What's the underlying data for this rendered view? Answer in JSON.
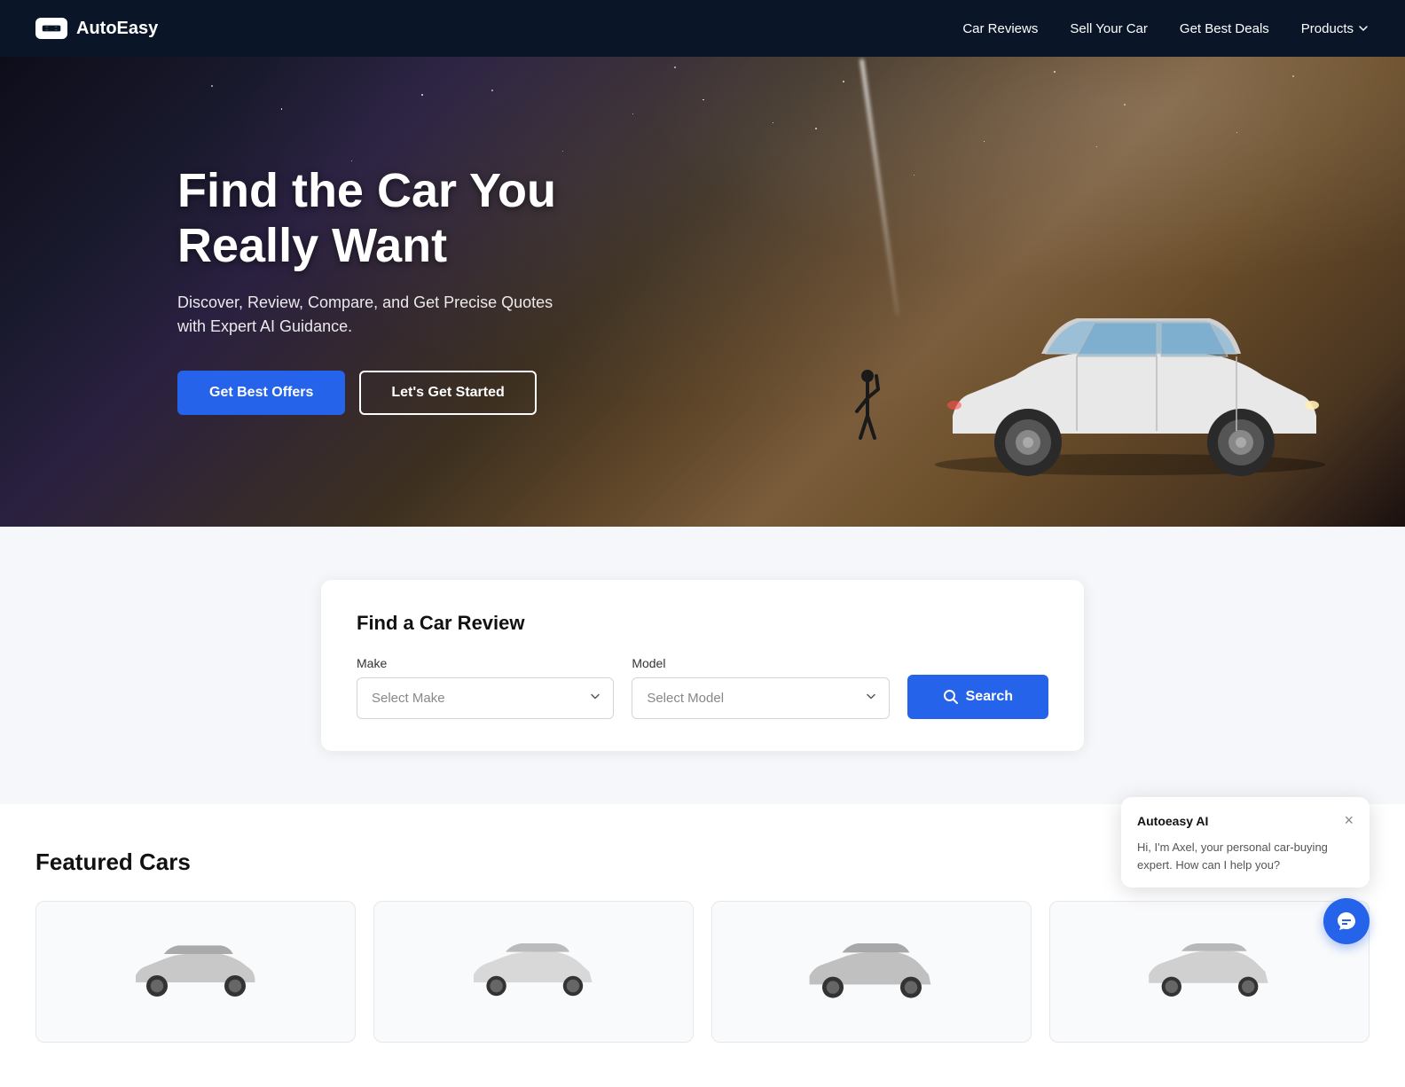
{
  "brand": {
    "name": "AutoEasy",
    "logo_alt": "AutoEasy logo"
  },
  "navbar": {
    "links": [
      {
        "label": "Car Reviews",
        "href": "#"
      },
      {
        "label": "Sell Your Car",
        "href": "#"
      },
      {
        "label": "Get Best Deals",
        "href": "#"
      },
      {
        "label": "Products",
        "href": "#",
        "has_dropdown": true
      }
    ]
  },
  "hero": {
    "title_line1": "Find the Car You",
    "title_line2": "Really Want",
    "subtitle": "Discover, Review, Compare, and Get Precise Quotes with Expert AI Guidance.",
    "cta_primary": "Get Best Offers",
    "cta_secondary": "Let's Get Started"
  },
  "search_card": {
    "title": "Find a Car Review",
    "make_label": "Make",
    "make_placeholder": "Select Make",
    "model_label": "Model",
    "model_placeholder": "Select Model",
    "search_button": "Search"
  },
  "featured": {
    "title": "Featured Cars"
  },
  "chatbot": {
    "name": "Autoeasy AI",
    "message": "Hi, I'm Axel, your personal car-buying expert.  How can I help you?",
    "close_label": "×"
  }
}
